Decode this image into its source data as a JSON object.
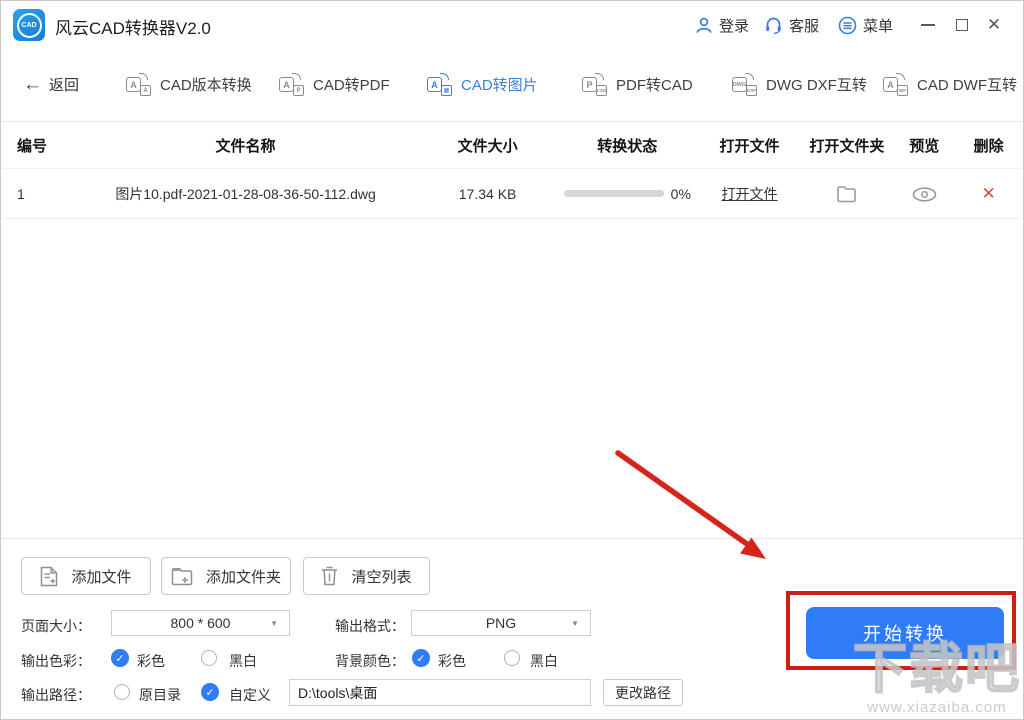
{
  "window": {
    "title": "风云CAD转换器V2.0",
    "logo_text": "CAD"
  },
  "titlebar": {
    "login": "登录",
    "service": "客服",
    "menu": "菜单"
  },
  "glyphs": {
    "back_arrow": "←",
    "caret": "▼",
    "check": "✓",
    "close": "✕",
    "delete": "✕"
  },
  "tabs": {
    "back": "返回",
    "items": [
      {
        "label": "CAD版本转换",
        "icon": "cad-version-convert-icon",
        "icon_main": "A",
        "icon_sub": "A",
        "active": false
      },
      {
        "label": "CAD转PDF",
        "icon": "cad-to-pdf-icon",
        "icon_main": "A",
        "icon_sub": "P",
        "active": false
      },
      {
        "label": "CAD转图片",
        "icon": "cad-to-image-icon",
        "icon_main": "A",
        "icon_sub": "▦",
        "active": true
      },
      {
        "label": "PDF转CAD",
        "icon": "pdf-to-cad-icon",
        "icon_main": "P",
        "icon_sub": "CAD",
        "active": false
      },
      {
        "label": "DWG DXF互转",
        "icon": "dwg-dxf-convert-icon",
        "icon_main": "DWG",
        "icon_sub": "DXF",
        "active": false
      },
      {
        "label": "CAD DWF互转",
        "icon": "cad-dwf-convert-icon",
        "icon_main": "A",
        "icon_sub": "WF",
        "active": false
      }
    ]
  },
  "table": {
    "headers": [
      "编号",
      "文件名称",
      "文件大小",
      "转换状态",
      "打开文件",
      "打开文件夹",
      "预览",
      "删除"
    ],
    "rows": [
      {
        "id": "1",
        "filename": "图片10.pdf-2021-01-28-08-36-50-112.dwg",
        "size": "17.34 KB",
        "progress_percent": "0%",
        "open_file": "打开文件"
      }
    ]
  },
  "actions": {
    "add_file": "添加文件",
    "add_folder": "添加文件夹",
    "clear_list": "清空列表"
  },
  "settings": {
    "page_size": {
      "label": "页面大小：",
      "value": "800 * 600"
    },
    "output_format": {
      "label": "输出格式：",
      "value": "PNG"
    },
    "output_color": {
      "label": "输出色彩：",
      "options": [
        {
          "label": "彩色",
          "checked": true
        },
        {
          "label": "黑白",
          "checked": false
        }
      ]
    },
    "bg_color": {
      "label": "背景颜色：",
      "options": [
        {
          "label": "彩色",
          "checked": true
        },
        {
          "label": "黑白",
          "checked": false
        }
      ]
    },
    "output_path": {
      "label": "输出路径：",
      "options": [
        {
          "label": "原目录",
          "checked": false
        },
        {
          "label": "自定义",
          "checked": true
        }
      ],
      "value": "D:\\tools\\桌面",
      "change_button": "更改路径"
    }
  },
  "convert": {
    "start": "开始转换"
  },
  "watermark": {
    "big": "下载吧",
    "url": "www.xiazaiba.com"
  },
  "colors": {
    "accent_blue": "#3d7edb",
    "button_blue": "#2f7cf6",
    "annotation_red": "#cf1d14",
    "progress_track": "#d6d6d6"
  }
}
